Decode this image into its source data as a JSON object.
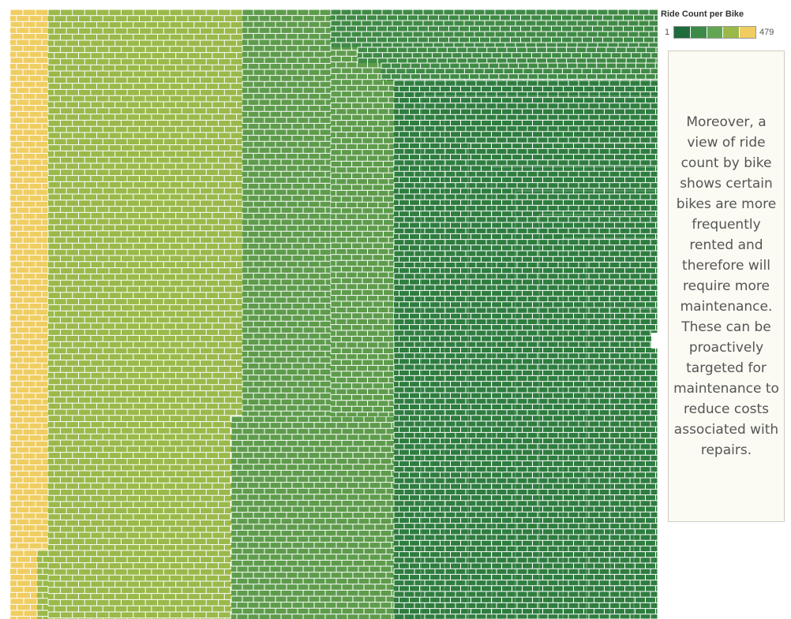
{
  "chart_data": {
    "type": "heatmap",
    "subtype": "treemap",
    "title": "",
    "legend": {
      "title": "Ride Count per Bike",
      "min_label": "1",
      "max_label": "479",
      "min": 1,
      "max": 479,
      "placement": "top-right",
      "colors": [
        "#1e6b3c",
        "#3c8a48",
        "#62a653",
        "#9ab94a",
        "#f0cd62"
      ]
    },
    "bands": [
      {
        "color": "#f0cd62",
        "count_range": [
          380,
          479
        ],
        "share": 0.058
      },
      {
        "color": "#9ab94a",
        "count_range": [
          280,
          380
        ],
        "share": 0.298
      },
      {
        "color": "#5e9c4c",
        "count_range": [
          180,
          280
        ],
        "share": 0.253
      },
      {
        "color": "#3f8a45",
        "count_range": [
          90,
          180
        ],
        "share": 0.137
      },
      {
        "color": "#2e7d3f",
        "count_range": [
          1,
          90
        ],
        "share": 0.254
      }
    ],
    "grid": true
  },
  "annotation": {
    "text": "Moreover, a view of ride count by bike shows certain bikes are more frequently rented and therefore will require more maintenance. These can be proactively targeted for maintenance to reduce costs associated with repairs."
  },
  "colors": {
    "border": "#ffffff",
    "note_background": "#fbfaf3",
    "note_border": "#cfcdc2",
    "note_text": "#555555"
  }
}
